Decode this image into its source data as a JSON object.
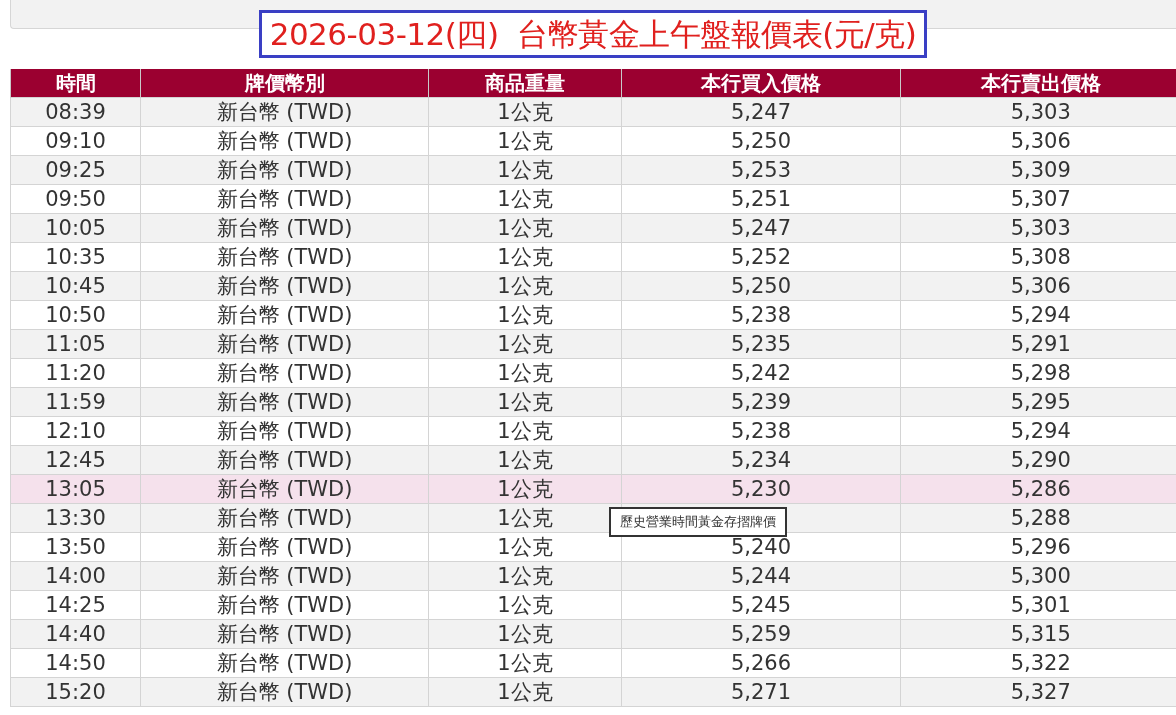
{
  "title": "2026-03-12(四)  台幣黃金上午盤報價表(元/克)",
  "table": {
    "columns": [
      "時間",
      "牌價幣別",
      "商品重量",
      "本行買入價格",
      "本行賣出價格"
    ],
    "rows": [
      {
        "time": "08:39",
        "currency": "新台幣 (TWD)",
        "weight": "1公克",
        "buy": "5,247",
        "sell": "5,303",
        "selected": false
      },
      {
        "time": "09:10",
        "currency": "新台幣 (TWD)",
        "weight": "1公克",
        "buy": "5,250",
        "sell": "5,306",
        "selected": false
      },
      {
        "time": "09:25",
        "currency": "新台幣 (TWD)",
        "weight": "1公克",
        "buy": "5,253",
        "sell": "5,309",
        "selected": false
      },
      {
        "time": "09:50",
        "currency": "新台幣 (TWD)",
        "weight": "1公克",
        "buy": "5,251",
        "sell": "5,307",
        "selected": false
      },
      {
        "time": "10:05",
        "currency": "新台幣 (TWD)",
        "weight": "1公克",
        "buy": "5,247",
        "sell": "5,303",
        "selected": false
      },
      {
        "time": "10:35",
        "currency": "新台幣 (TWD)",
        "weight": "1公克",
        "buy": "5,252",
        "sell": "5,308",
        "selected": false
      },
      {
        "time": "10:45",
        "currency": "新台幣 (TWD)",
        "weight": "1公克",
        "buy": "5,250",
        "sell": "5,306",
        "selected": false
      },
      {
        "time": "10:50",
        "currency": "新台幣 (TWD)",
        "weight": "1公克",
        "buy": "5,238",
        "sell": "5,294",
        "selected": false
      },
      {
        "time": "11:05",
        "currency": "新台幣 (TWD)",
        "weight": "1公克",
        "buy": "5,235",
        "sell": "5,291",
        "selected": false
      },
      {
        "time": "11:20",
        "currency": "新台幣 (TWD)",
        "weight": "1公克",
        "buy": "5,242",
        "sell": "5,298",
        "selected": false
      },
      {
        "time": "11:59",
        "currency": "新台幣 (TWD)",
        "weight": "1公克",
        "buy": "5,239",
        "sell": "5,295",
        "selected": false
      },
      {
        "time": "12:10",
        "currency": "新台幣 (TWD)",
        "weight": "1公克",
        "buy": "5,238",
        "sell": "5,294",
        "selected": false
      },
      {
        "time": "12:45",
        "currency": "新台幣 (TWD)",
        "weight": "1公克",
        "buy": "5,234",
        "sell": "5,290",
        "selected": false
      },
      {
        "time": "13:05",
        "currency": "新台幣 (TWD)",
        "weight": "1公克",
        "buy": "5,230",
        "sell": "5,286",
        "selected": true
      },
      {
        "time": "13:30",
        "currency": "新台幣 (TWD)",
        "weight": "1公克",
        "sell": "5,288",
        "selected": false
      },
      {
        "time": "13:50",
        "currency": "新台幣 (TWD)",
        "weight": "1公克",
        "buy": "5,240",
        "sell": "5,296",
        "selected": false
      },
      {
        "time": "14:00",
        "currency": "新台幣 (TWD)",
        "weight": "1公克",
        "buy": "5,244",
        "sell": "5,300",
        "selected": false
      },
      {
        "time": "14:25",
        "currency": "新台幣 (TWD)",
        "weight": "1公克",
        "buy": "5,245",
        "sell": "5,301",
        "selected": false
      },
      {
        "time": "14:40",
        "currency": "新台幣 (TWD)",
        "weight": "1公克",
        "buy": "5,259",
        "sell": "5,315",
        "selected": false
      },
      {
        "time": "14:50",
        "currency": "新台幣 (TWD)",
        "weight": "1公克",
        "buy": "5,266",
        "sell": "5,322",
        "selected": false
      },
      {
        "time": "15:20",
        "currency": "新台幣 (TWD)",
        "weight": "1公克",
        "buy": "5,271",
        "sell": "5,327",
        "selected": false
      }
    ]
  },
  "tooltip": "歷史營業時間黃金存摺牌價"
}
